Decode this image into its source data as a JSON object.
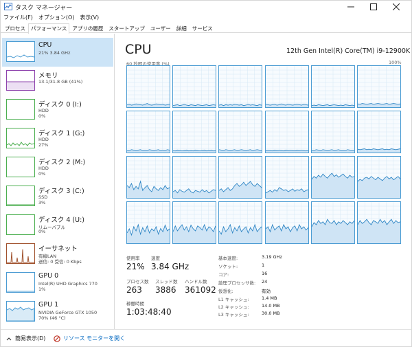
{
  "window": {
    "title": "タスク マネージャー"
  },
  "menu": [
    "ファイル(F)",
    "オプション(O)",
    "表示(V)"
  ],
  "tabs": [
    "プロセス",
    "パフォーマンス",
    "アプリの履歴",
    "スタートアップ",
    "ユーザー",
    "詳細",
    "サービス"
  ],
  "sidebar": {
    "items": [
      {
        "title": "CPU",
        "line1": "21%  3.84 GHz",
        "line2": "",
        "color": "#4b9cd3",
        "icon": "cpu-graph"
      },
      {
        "title": "メモリ",
        "line1": "13.1/31.8 GB (41%)",
        "line2": "",
        "color": "#8e44ad",
        "icon": "memory-graph"
      },
      {
        "title": "ディスク 0 (I:)",
        "line1": "HDD",
        "line2": "0%",
        "color": "#4caf50",
        "icon": "disk-graph"
      },
      {
        "title": "ディスク 1 (G:)",
        "line1": "HDD",
        "line2": "27%",
        "color": "#4caf50",
        "icon": "disk-graph"
      },
      {
        "title": "ディスク 2 (M:)",
        "line1": "HDD",
        "line2": "0%",
        "color": "#4caf50",
        "icon": "disk-graph"
      },
      {
        "title": "ディスク 3 (C:)",
        "line1": "SSD",
        "line2": "3%",
        "color": "#4caf50",
        "icon": "disk-graph"
      },
      {
        "title": "ディスク 4 (U:)",
        "line1": "リムーバブル",
        "line2": "0%",
        "color": "#4caf50",
        "icon": "disk-graph"
      },
      {
        "title": "イーサネット",
        "line1": "有線LAN",
        "line2": "送信: 0 受信: 0 Kbps",
        "color": "#a0522d",
        "icon": "network-graph"
      },
      {
        "title": "GPU 0",
        "line1": "Intel(R) UHD Graphics 770",
        "line2": "1%",
        "color": "#4b9cd3",
        "icon": "gpu-graph"
      },
      {
        "title": "GPU 1",
        "line1": "NVIDIA GeForce GTX 1050",
        "line2": "70% (46 °C)",
        "color": "#4b9cd3",
        "icon": "gpu-graph"
      }
    ]
  },
  "main": {
    "title": "CPU",
    "model": "12th Gen Intel(R) Core(TM) i9-12900K",
    "graph_caption": "60 秒間の使用率 (%)",
    "graph_max": "100%",
    "cores": [
      [
        6,
        7,
        5,
        6,
        8,
        7,
        6,
        5,
        7,
        9,
        6,
        5,
        6,
        8,
        7,
        6,
        7,
        5,
        6,
        7
      ],
      [
        4,
        5,
        6,
        4,
        5,
        7,
        5,
        4,
        6,
        5,
        4,
        6,
        5,
        4,
        5,
        6,
        4,
        5,
        6,
        5
      ],
      [
        5,
        6,
        4,
        6,
        5,
        6,
        5,
        7,
        6,
        5,
        6,
        4,
        5,
        7,
        5,
        6,
        5,
        4,
        6,
        5
      ],
      [
        7,
        6,
        5,
        6,
        7,
        5,
        6,
        8,
        6,
        5,
        7,
        6,
        5,
        6,
        7,
        6,
        5,
        7,
        6,
        5
      ],
      [
        4,
        5,
        4,
        6,
        5,
        4,
        5,
        6,
        4,
        5,
        6,
        5,
        4,
        5,
        4,
        6,
        5,
        4,
        5,
        4
      ],
      [
        8,
        7,
        9,
        8,
        7,
        8,
        9,
        7,
        8,
        9,
        8,
        7,
        8,
        9,
        7,
        8,
        9,
        8,
        7,
        8
      ],
      [
        6,
        5,
        7,
        6,
        5,
        6,
        7,
        5,
        6,
        5,
        7,
        6,
        5,
        6,
        7,
        5,
        6,
        5,
        7,
        6
      ],
      [
        5,
        4,
        6,
        5,
        4,
        5,
        6,
        4,
        5,
        4,
        6,
        5,
        4,
        5,
        6,
        4,
        5,
        6,
        4,
        5
      ],
      [
        7,
        6,
        5,
        7,
        6,
        5,
        6,
        7,
        5,
        6,
        7,
        6,
        5,
        6,
        7,
        5,
        6,
        7,
        6,
        5
      ],
      [
        5,
        6,
        5,
        4,
        6,
        5,
        6,
        5,
        4,
        6,
        5,
        6,
        5,
        4,
        6,
        5,
        6,
        5,
        4,
        6
      ],
      [
        6,
        5,
        7,
        6,
        5,
        7,
        6,
        5,
        6,
        7,
        5,
        6,
        7,
        5,
        6,
        5,
        7,
        6,
        5,
        6
      ],
      [
        8,
        7,
        8,
        9,
        7,
        8,
        7,
        9,
        8,
        7,
        8,
        9,
        7,
        8,
        7,
        9,
        8,
        7,
        8,
        9
      ],
      [
        30,
        25,
        35,
        20,
        28,
        22,
        40,
        18,
        25,
        30,
        20,
        15,
        28,
        22,
        18,
        25,
        20,
        30,
        22,
        25
      ],
      [
        15,
        18,
        12,
        20,
        16,
        14,
        18,
        22,
        15,
        12,
        18,
        16,
        14,
        20,
        15,
        18,
        12,
        16,
        20,
        18
      ],
      [
        18,
        22,
        15,
        20,
        25,
        18,
        22,
        30,
        35,
        28,
        32,
        38,
        30,
        35,
        40,
        32,
        28,
        35,
        30,
        25
      ],
      [
        12,
        15,
        18,
        14,
        20,
        16,
        25,
        22,
        18,
        20,
        15,
        18,
        22,
        16,
        20,
        18,
        22,
        15,
        18,
        20
      ],
      [
        45,
        52,
        48,
        55,
        50,
        58,
        52,
        48,
        55,
        60,
        52,
        56,
        50,
        54,
        58,
        52,
        48,
        55,
        50,
        52
      ],
      [
        40,
        45,
        42,
        48,
        50,
        46,
        52,
        48,
        44,
        50,
        46,
        42,
        48,
        52,
        46,
        50,
        44,
        48,
        52,
        46
      ],
      [
        25,
        35,
        20,
        40,
        30,
        45,
        22,
        38,
        28,
        42,
        25,
        35,
        30,
        40,
        22,
        36,
        28,
        44,
        30,
        35
      ],
      [
        28,
        42,
        30,
        38,
        45,
        32,
        40,
        28,
        44,
        35,
        30,
        42,
        38,
        32,
        45,
        30,
        40,
        36,
        28,
        42
      ],
      [
        30,
        22,
        40,
        28,
        35,
        45,
        25,
        38,
        30,
        42,
        28,
        35,
        40,
        25,
        38,
        30,
        45,
        28,
        35,
        40
      ],
      [
        35,
        40,
        28,
        45,
        32,
        38,
        42,
        30,
        45,
        35,
        40,
        28,
        38,
        42,
        30,
        45,
        35,
        40,
        32,
        38
      ],
      [
        40,
        50,
        45,
        55,
        48,
        52,
        45,
        58,
        50,
        48,
        55,
        45,
        52,
        48,
        55,
        50,
        45,
        52,
        48,
        55
      ],
      [
        45,
        55,
        48,
        52,
        58,
        50,
        45,
        55,
        52,
        48,
        58,
        50,
        55,
        45,
        52,
        58,
        48,
        55,
        50,
        52
      ]
    ],
    "stats": {
      "usage_label": "使用率",
      "usage_value": "21%",
      "speed_label": "速度",
      "speed_value": "3.84 GHz",
      "processes_label": "プロセス数",
      "processes_value": "263",
      "threads_label": "スレッド数",
      "threads_value": "3886",
      "handles_label": "ハンドル数",
      "handles_value": "361092",
      "uptime_label": "稼働時間",
      "uptime_value": "1:03:48:40"
    },
    "specs": [
      {
        "label": "基本速度:",
        "value": "3.19 GHz"
      },
      {
        "label": "ソケット:",
        "value": "1"
      },
      {
        "label": "コア:",
        "value": "16"
      },
      {
        "label": "論理プロセッサ数:",
        "value": "24"
      },
      {
        "label": "仮想化:",
        "value": "有効"
      },
      {
        "label": "L1 キャッシュ:",
        "value": "1.4 MB"
      },
      {
        "label": "L2 キャッシュ:",
        "value": "14.0 MB"
      },
      {
        "label": "L3 キャッシュ:",
        "value": "30.0 MB"
      }
    ]
  },
  "footer": {
    "collapse_label": "簡易表示(D)",
    "resource_monitor_label": "リソース モニターを開く"
  }
}
